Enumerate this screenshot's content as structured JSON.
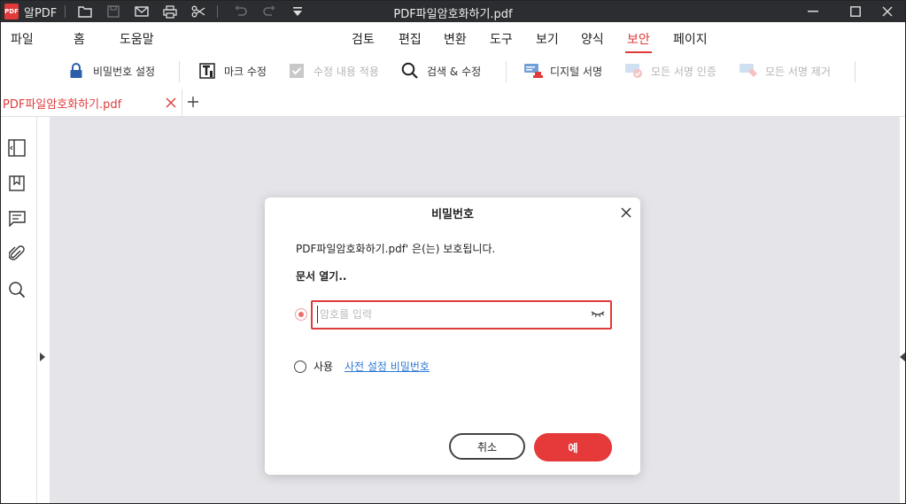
{
  "titlebar": {
    "app_name": "알PDF",
    "logo_text": "PDF",
    "doc_title": "PDF파일암호화하기.pdf"
  },
  "menu": {
    "left": [
      "파일",
      "홈",
      "도움말"
    ],
    "center": [
      "검토",
      "편집",
      "변환",
      "도구",
      "보기",
      "양식",
      "보안",
      "페이지"
    ],
    "active": "보안"
  },
  "toolbar": {
    "password_settings": "비밀번호 설정",
    "mark_edit": "마크 수정",
    "apply_edits": "수정 내용 적용",
    "search_edit": "검색 & 수정",
    "digital_signature": "디지털 서명",
    "verify_all_signatures": "모든 서명 인증",
    "remove_all_signatures": "모든 서명 제거"
  },
  "tabs": [
    {
      "label": "PDF파일암호화하기.pdf"
    }
  ],
  "dialog": {
    "title": "비밀번호",
    "message": "PDF파일암호화하기.pdf' 은(는) 보호됩니다.",
    "subtitle": "문서 열기..",
    "password_placeholder": "암호를 입력",
    "password_value": "",
    "use_label": "사용",
    "preset_link": "사전 설정 비밀번호",
    "cancel_label": "취소",
    "ok_label": "예"
  },
  "colors": {
    "accent": "#e03a3a",
    "link": "#2e7bd6",
    "titlebar_bg": "#2b2d31",
    "canvas_bg": "#e5e5e9"
  }
}
